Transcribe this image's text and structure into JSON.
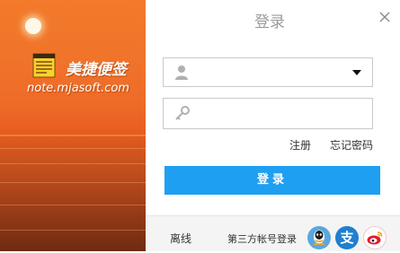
{
  "window": {
    "title": "登录"
  },
  "banner": {
    "brand_name": "美捷便签",
    "brand_url": "note.mjasoft.com"
  },
  "form": {
    "account": {
      "value": "",
      "placeholder": ""
    },
    "password": {
      "value": "",
      "placeholder": ""
    },
    "register_label": "注册",
    "forgot_label": "忘记密码",
    "login_label": "登录"
  },
  "footer": {
    "offline_label": "离线",
    "third_party_label": "第三方帐号登录",
    "alipay_glyph": "支"
  },
  "icons": {
    "account": "user-icon",
    "password": "key-icon",
    "close": "close-icon",
    "qq": "qq-icon",
    "alipay": "alipay-icon",
    "weibo": "weibo-icon"
  },
  "colors": {
    "accent": "#1e9ff2",
    "title": "#9a9a9a",
    "qq": "#5aa7e0",
    "alipay": "#1f7fd0",
    "weibo": "#e6162d"
  }
}
